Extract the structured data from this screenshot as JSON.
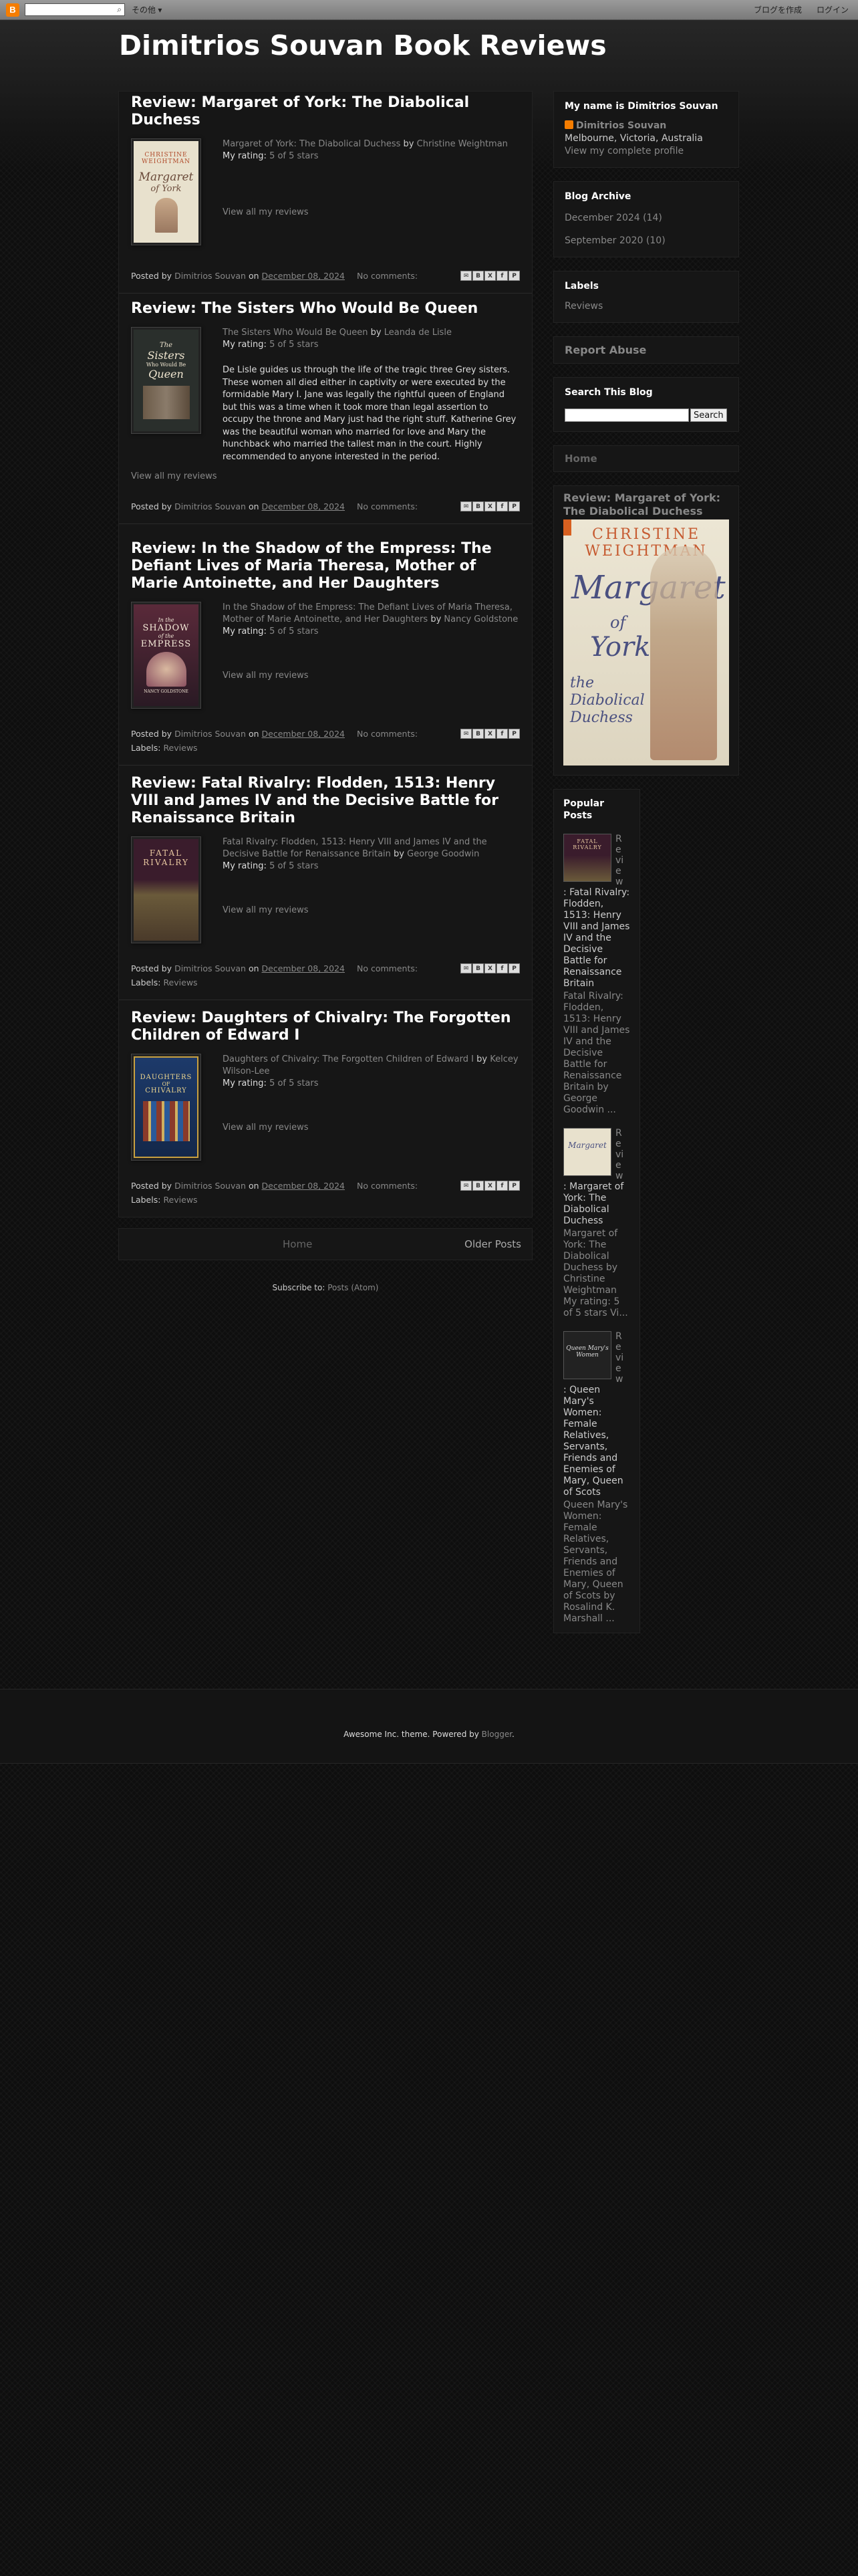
{
  "navbar": {
    "more_label": "その他 ▾",
    "create_blog": "ブログを作成",
    "login": "ログイン"
  },
  "site": {
    "title": "Dimitrios Souvan Book Reviews"
  },
  "posts": [
    {
      "title": "Review: Margaret of York: The Diabolical Duchess",
      "book": "Margaret of York: The Diabolical Duchess",
      "by": "by",
      "author": "Christine Weightman",
      "rating_label": "My rating:",
      "rating": "5 of 5 stars",
      "view_all": "View all my reviews",
      "posted_by": "Posted by",
      "blogger": "Dimitrios Souvan",
      "on": "on",
      "date": "December 08, 2024",
      "comments": "No comments:",
      "cover": {
        "line1": "CHRISTINE",
        "line2": "WEIGHTMAN",
        "line3": "Margaret",
        "line4": "of York",
        "bg": "#e8e1cd"
      }
    },
    {
      "title": "Review: The Sisters Who Would Be Queen",
      "book": "The Sisters Who Would Be Queen",
      "by": "by",
      "author": "Leanda de Lisle",
      "rating_label": "My rating:",
      "rating": "5 of 5 stars",
      "review_text": "De Lisle guides us through the life of the tragic three Grey sisters. These women all died either in captivity or were executed by the formidable Mary I. Jane was legally the rightful queen of England but this was a time when it took more than legal assertion to occupy the throne and Mary just had the right stuff. Katherine Grey was the beautiful woman who married for love and Mary the hunchback who married the tallest man in the court. Highly recommended to anyone interested in the period.",
      "view_all": "View all my reviews",
      "posted_by": "Posted by",
      "blogger": "Dimitrios Souvan",
      "on": "on",
      "date": "December 08, 2024",
      "comments": "No comments:",
      "cover": {
        "line1": "The",
        "line2": "Sisters",
        "line3": "Who Would Be",
        "line4": "Queen",
        "bg": "#2a2f2c"
      }
    },
    {
      "title": "Review: In the Shadow of the Empress: The Defiant Lives of Maria Theresa, Mother of Marie Antoinette, and Her Daughters",
      "book": "In the Shadow of the Empress: The Defiant Lives of Maria Theresa, Mother of Marie Antoinette, and Her Daughters",
      "by": "by",
      "author": "Nancy Goldstone",
      "rating_label": "My rating:",
      "rating": "5 of 5 stars",
      "view_all": "View all my reviews",
      "posted_by": "Posted by",
      "blogger": "Dimitrios Souvan",
      "on": "on",
      "date": "December 08, 2024",
      "comments": "No comments:",
      "labels_prefix": "Labels:",
      "label": "Reviews",
      "cover": {
        "line1": "In the",
        "line2": "SHADOW",
        "line3": "of the",
        "line4": "EMPRESS",
        "line5": "NANCY GOLDSTONE",
        "bg": "#3a2030"
      }
    },
    {
      "title": "Review: Fatal Rivalry: Flodden, 1513: Henry VIII and James IV and the Decisive Battle for Renaissance Britain",
      "book": "Fatal Rivalry: Flodden, 1513: Henry VIII and James IV and the Decisive Battle for Renaissance Britain",
      "by": "by",
      "author": "George Goodwin",
      "rating_label": "My rating:",
      "rating": "5 of 5 stars",
      "view_all": "View all my reviews",
      "posted_by": "Posted by",
      "blogger": "Dimitrios Souvan",
      "on": "on",
      "date": "December 08, 2024",
      "comments": "No comments:",
      "labels_prefix": "Labels:",
      "label": "Reviews",
      "cover": {
        "line1": "FATAL",
        "line2": "RIVALRY",
        "line3": "",
        "line4": "",
        "bg": "#3a1c2c"
      }
    },
    {
      "title": "Review: Daughters of Chivalry: The Forgotten Children of Edward I",
      "book": "Daughters of Chivalry: The Forgotten Children of Edward I",
      "by": "by",
      "author": "Kelcey Wilson-Lee",
      "rating_label": "My rating:",
      "rating": "5 of 5 stars",
      "view_all": "View all my reviews",
      "posted_by": "Posted by",
      "blogger": "Dimitrios Souvan",
      "on": "on",
      "date": "December 08, 2024",
      "comments": "No comments:",
      "labels_prefix": "Labels:",
      "label": "Reviews",
      "cover": {
        "line1": "DAUGHTERS",
        "line2": "OF",
        "line3": "CHIVALRY",
        "line4": "",
        "bg": "#1d3a6a"
      }
    }
  ],
  "pager": {
    "home": "Home",
    "older": "Older Posts"
  },
  "subscribe": {
    "prefix": "Subscribe to:",
    "link": "Posts (Atom)"
  },
  "sidebar": {
    "profile": {
      "heading": "My name is Dimitrios Souvan",
      "name": "Dimitrios Souvan",
      "location": "Melbourne, Victoria, Australia",
      "link": "View my complete profile"
    },
    "archive": {
      "heading": "Blog Archive",
      "items": [
        {
          "label": "December 2024",
          "count": "(14)"
        },
        {
          "label": "September 2020",
          "count": "(10)"
        }
      ]
    },
    "labels": {
      "heading": "Labels",
      "item": "Reviews"
    },
    "report_abuse": "Report Abuse",
    "search": {
      "heading": "Search This Blog",
      "button": "Search"
    },
    "home_link": "Home",
    "featured": {
      "title": "Review: Margaret of York: The Diabolical Duchess",
      "cover_author": "CHRISTINE WEIGHTMAN",
      "cover_title1": "Margaret",
      "cover_title2": "of",
      "cover_title3": "York",
      "cover_subtitle": "the Diabolical Duchess"
    },
    "popular": {
      "heading": "Popular Posts",
      "items": [
        {
          "vert": "Review",
          "title": ": Fatal Rivalry: Flodden, 1513: Henry VIII and James IV and the Decisive Battle for Renaissance Britain",
          "snippet": "Fatal Rivalry: Flodden, 1513: Henry VIII and James IV and the Decisive Battle for Renaissance Britain by George Goodwin ...",
          "thumb_text": "FATAL RIVALRY",
          "thumb_bg": "#3a1c2c"
        },
        {
          "vert": "Review",
          "title": ": Margaret of York: The Diabolical Duchess",
          "snippet": "Margaret of York: The Diabolical Duchess by Christine Weightman My rating: 5 of 5 stars Vi...",
          "thumb_text": "Margaret",
          "thumb_bg": "#e8e1cd"
        },
        {
          "vert": "Review",
          "title": ": Queen Mary's Women: Female Relatives, Servants, Friends and Enemies of Mary, Queen of Scots",
          "snippet": "Queen Mary's Women: Female Relatives, Servants, Friends and Enemies of Mary, Queen of Scots by Rosalind K. Marshall ...",
          "thumb_text": "Queen Mary's Women",
          "thumb_bg": "#222222"
        }
      ]
    }
  },
  "footer": {
    "text": "Awesome Inc. theme. Powered by",
    "link": "Blogger",
    "period": "."
  }
}
